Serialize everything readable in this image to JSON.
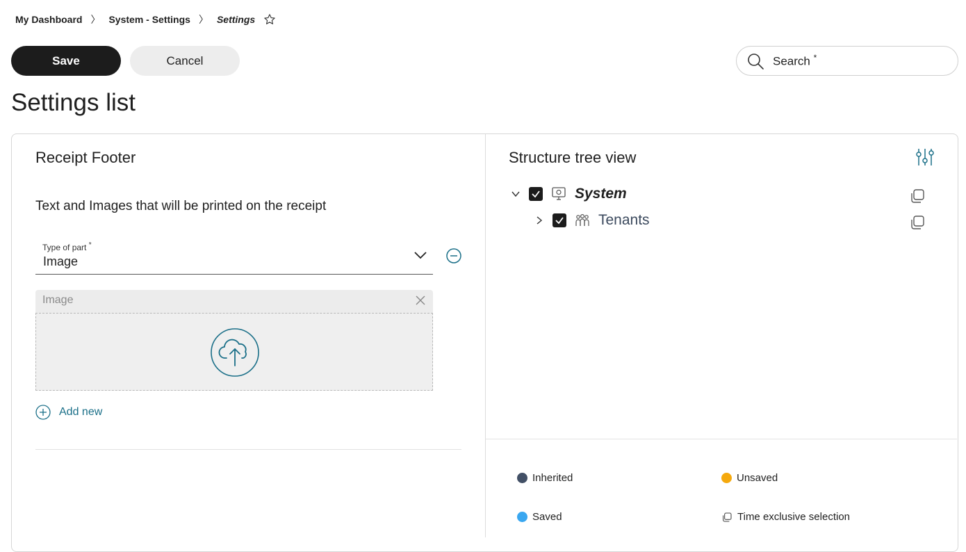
{
  "breadcrumb": {
    "items": [
      "My Dashboard",
      "System - Settings",
      "Settings"
    ],
    "separator": "〉"
  },
  "toolbar": {
    "save_label": "Save",
    "cancel_label": "Cancel"
  },
  "search": {
    "placeholder": "Search",
    "required_mark": "*"
  },
  "page": {
    "title": "Settings list"
  },
  "left_panel": {
    "title": "Receipt Footer",
    "subtitle": "Text and Images that will be printed on the receipt",
    "type_field": {
      "label": "Type of part",
      "required_mark": "*",
      "value": "Image"
    },
    "image_box": {
      "label": "Image"
    },
    "add_new_label": "Add new"
  },
  "right_panel": {
    "title": "Structure tree view",
    "tree": [
      {
        "label": "System",
        "checked": true,
        "expanded": true
      },
      {
        "label": "Tenants",
        "checked": true,
        "expanded": false
      }
    ],
    "legend": [
      {
        "label": "Inherited",
        "color": "#425066"
      },
      {
        "label": "Unsaved",
        "color": "#f5a90d"
      },
      {
        "label": "Saved",
        "color": "#3aa7f0"
      },
      {
        "label": "Time exclusive selection",
        "icon": "copy-icon"
      }
    ]
  },
  "colors": {
    "accent": "#1a6f88",
    "dark": "#1c1c1c"
  }
}
